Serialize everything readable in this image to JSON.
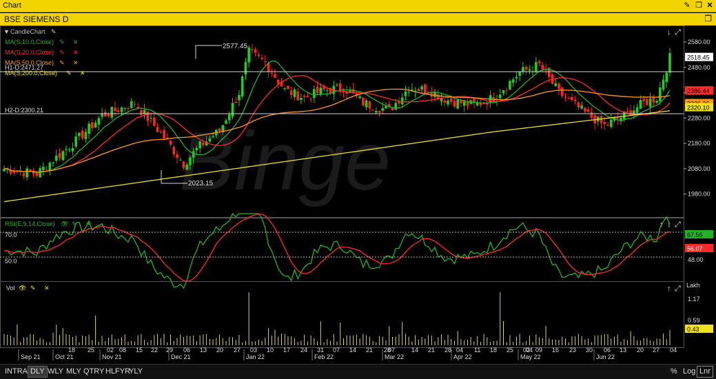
{
  "window": {
    "title": "Chart"
  },
  "symbol_bar": {
    "symbol": "BSE SIEMENS D"
  },
  "price_panel": {
    "overlays": [
      {
        "label": "CandleChart",
        "color": "#c8c8c8"
      },
      {
        "label": "MA(S,10.0,Close)",
        "color": "#22b322"
      },
      {
        "label": "MA(S,20.0,Close)",
        "color": "#ff2a2a"
      },
      {
        "label": "MA(S,50.0,Close)",
        "color": "#ff9a1a"
      },
      {
        "label": "MA(S,200.0,Close)",
        "color": "#f0e020"
      }
    ],
    "h1_label": "H1-D:2471.27",
    "h2_label": "H2-D:2300.21",
    "high_label": "2577.45",
    "low_label": "2023.15",
    "watermark": "Binge",
    "axis_ticks": [
      "2580.00",
      "2480.00",
      "2380.00",
      "2280.00",
      "2180.00",
      "2080.00",
      "1980.00"
    ],
    "badges": [
      {
        "text": "2518.45",
        "bg": "#ffffff",
        "fg": "#000000"
      },
      {
        "text": "2386.44",
        "bg": "#ff2a2a",
        "fg": "#000000"
      },
      {
        "text": "2336.36",
        "bg": "#ff9a1a",
        "fg": "#000000"
      },
      {
        "text": "2320.10",
        "bg": "#f0e020",
        "fg": "#000000"
      }
    ]
  },
  "rsi_panel": {
    "label": "RSI(E,9,14,Close)",
    "level_high": "70.0",
    "level_low": "50.0",
    "axis_ticks": [
      "48.00"
    ],
    "badges": [
      {
        "text": "67.56",
        "bg": "#22b322",
        "fg": "#000000"
      },
      {
        "text": "56.07",
        "bg": "#ff2a2a",
        "fg": "#ffffff"
      }
    ],
    "top_tick": "68.00"
  },
  "volume_panel": {
    "label": "Vol",
    "unit": "Lakh",
    "axis_ticks": [
      "1.17",
      "0.59"
    ],
    "badge": {
      "text": "0.43",
      "bg": "#f0e020",
      "fg": "#000000"
    }
  },
  "x_axis": {
    "labels": [
      "Sep 21",
      "18",
      "Oct 21",
      "25",
      "02",
      "Nov 21",
      "08",
      "15",
      "22",
      "29",
      "Dec 21",
      "06",
      "13",
      "20",
      "27",
      "03",
      "Jan 22",
      "10",
      "17",
      "24",
      "31",
      "Feb 22",
      "07",
      "14",
      "21",
      "28",
      "07",
      "Mar 22",
      "14",
      "21",
      "28",
      "04",
      "Apr 22",
      "11",
      "18",
      "25",
      "02",
      "04",
      "May 22",
      "09",
      "16",
      "23",
      "30",
      "06",
      "Jun 22",
      "13",
      "20",
      "27",
      "04"
    ]
  },
  "timeframes": [
    "INTRA",
    "DLY",
    "WLY",
    "MLY",
    "QTRY",
    "HLFYR",
    "YLY"
  ],
  "active_timeframe": "DLY",
  "scale_buttons": [
    "%",
    "Log",
    "Lnr"
  ],
  "active_scale": "Lnr"
}
